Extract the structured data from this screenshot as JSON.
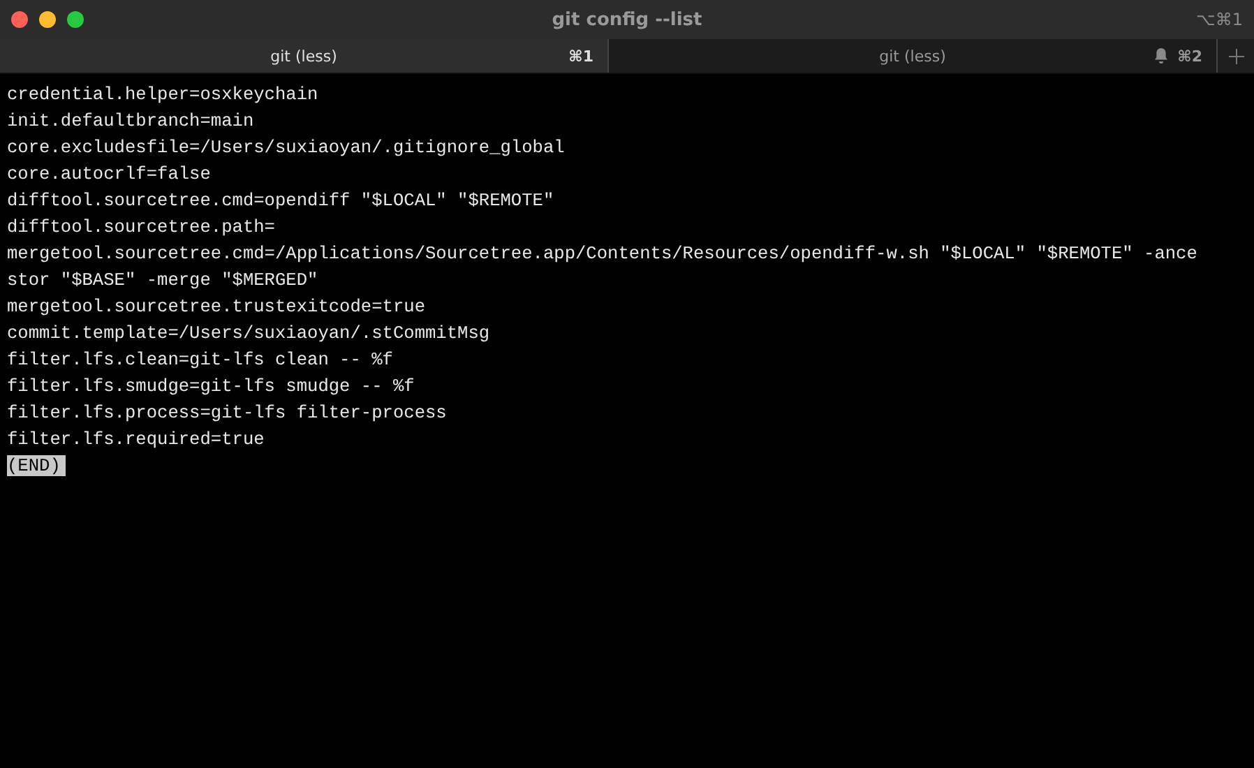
{
  "window": {
    "title": "git config --list",
    "shortcut": "⌥⌘1"
  },
  "tabs": [
    {
      "label": "git (less)",
      "shortcut": "⌘1",
      "selected": true,
      "bell": false
    },
    {
      "label": "git (less)",
      "shortcut": "⌘2",
      "selected": false,
      "bell": true
    }
  ],
  "terminal": {
    "lines": [
      {
        "kind": "output",
        "text": "credential.helper=osxkeychain"
      },
      {
        "kind": "output",
        "text": "init.defaultbranch=main"
      },
      {
        "kind": "output",
        "text": "core.excludesfile=/Users/suxiaoyan/.gitignore_global"
      },
      {
        "kind": "output",
        "text": "core.autocrlf=false"
      },
      {
        "kind": "output",
        "text": "difftool.sourcetree.cmd=opendiff \"$LOCAL\" \"$REMOTE\""
      },
      {
        "kind": "output",
        "text": "difftool.sourcetree.path="
      },
      {
        "kind": "output",
        "text": "mergetool.sourcetree.cmd=/Applications/Sourcetree.app/Contents/Resources/opendiff-w.sh \"$LOCAL\" \"$REMOTE\" -ance"
      },
      {
        "kind": "output",
        "text": "stor \"$BASE\" -merge \"$MERGED\""
      },
      {
        "kind": "output",
        "text": "mergetool.sourcetree.trustexitcode=true"
      },
      {
        "kind": "output",
        "text": "commit.template=/Users/suxiaoyan/.stCommitMsg"
      },
      {
        "kind": "output",
        "text": "filter.lfs.clean=git-lfs clean -- %f"
      },
      {
        "kind": "output",
        "text": "filter.lfs.smudge=git-lfs smudge -- %f"
      },
      {
        "kind": "output",
        "text": "filter.lfs.process=git-lfs filter-process"
      },
      {
        "kind": "output",
        "text": "filter.lfs.required=true"
      },
      {
        "kind": "prompt",
        "text": "(END)"
      }
    ]
  }
}
